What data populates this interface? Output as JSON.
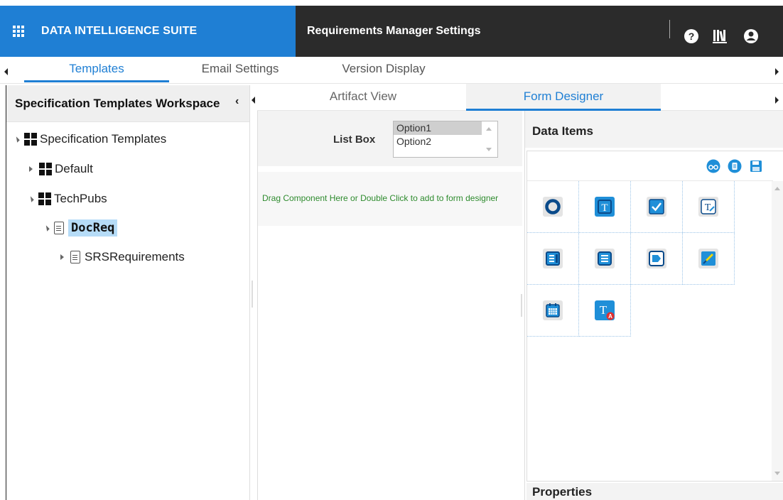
{
  "header": {
    "brand": "DATA INTELLIGENCE SUITE",
    "title": "Requirements Manager Settings",
    "icons": [
      "help-icon",
      "library-icon",
      "user-icon"
    ],
    "colors": {
      "brand_bg": "#1f7fd4",
      "appbar_bg": "#2b2b2b"
    }
  },
  "main_tabs": [
    {
      "label": "Templates",
      "active": true
    },
    {
      "label": "Email Settings",
      "active": false
    },
    {
      "label": "Version Display",
      "active": false
    }
  ],
  "left_panel": {
    "title": "Specification Templates Workspace",
    "tree": {
      "root": "Specification Templates",
      "default": "Default",
      "techpubs": "TechPubs",
      "docreq": "DocReq",
      "srs": "SRSRequirements"
    }
  },
  "sub_tabs": [
    {
      "label": "Artifact View",
      "active": false
    },
    {
      "label": "Form Designer",
      "active": true
    }
  ],
  "form": {
    "list_box_label": "List Box",
    "list_box_options": [
      "Option1",
      "Option2"
    ],
    "selected_option": "Option1",
    "drop_hint": "Drag Component Here or Double Click to add to form designer"
  },
  "data_items": {
    "title": "Data Items",
    "toolbar_icons": [
      "view-icon",
      "document-icon",
      "save-icon"
    ],
    "components": [
      "radio-button-icon",
      "text-field-icon",
      "checkbox-icon",
      "text-area-icon",
      "list-box-icon",
      "list-icon",
      "tag-icon",
      "color-picker-icon",
      "date-picker-icon",
      "text-font-icon"
    ]
  },
  "properties": {
    "title": "Properties"
  }
}
